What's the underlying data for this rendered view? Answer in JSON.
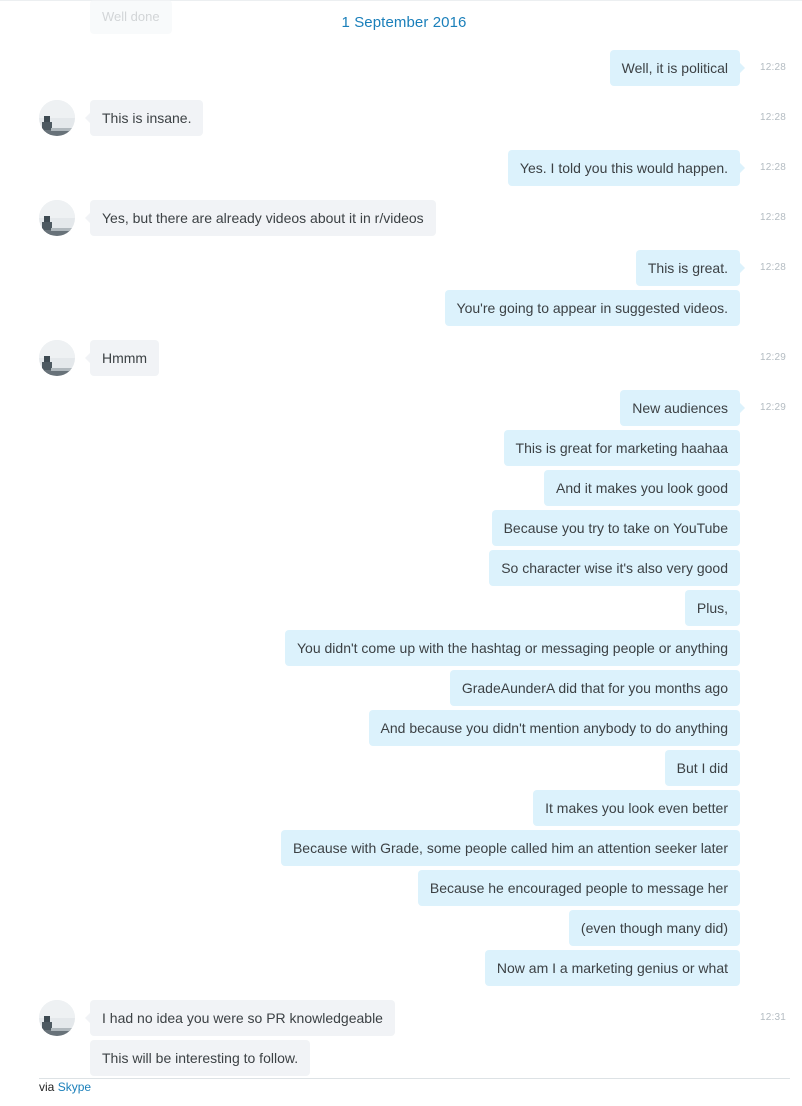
{
  "chat": {
    "partial_previous_message": "Well done",
    "date_header": "1 September 2016",
    "messages": [
      {
        "dir": "out",
        "text": "Well, it is political",
        "time": "12:28"
      },
      {
        "dir": "in",
        "text": "This is insane.",
        "time": "12:28",
        "avatar": true
      },
      {
        "dir": "out",
        "text": "Yes. I told you this would happen.",
        "time": "12:28"
      },
      {
        "dir": "in",
        "text": "Yes, but there are already videos about it in r/videos",
        "time": "12:28",
        "avatar": true
      },
      {
        "dir": "out",
        "text": "This is great.",
        "time": "12:28"
      },
      {
        "dir": "out",
        "text": "You're going to appear in suggested videos.",
        "time": ""
      },
      {
        "dir": "in",
        "text": "Hmmm",
        "time": "12:29",
        "avatar": true
      },
      {
        "dir": "out",
        "text": "New audiences",
        "time": "12:29"
      },
      {
        "dir": "out",
        "text": "This is great for marketing haahaa",
        "time": ""
      },
      {
        "dir": "out",
        "text": "And it makes you look good",
        "time": ""
      },
      {
        "dir": "out",
        "text": "Because you try to take on YouTube",
        "time": ""
      },
      {
        "dir": "out",
        "text": "So character wise it's also very good",
        "time": ""
      },
      {
        "dir": "out",
        "text": "Plus,",
        "time": ""
      },
      {
        "dir": "out",
        "text": "You didn't come up with the hashtag or messaging people or anything",
        "time": ""
      },
      {
        "dir": "out",
        "text": "GradeAunderA did that for you months ago",
        "time": ""
      },
      {
        "dir": "out",
        "text": "And because you didn't mention anybody to do anything",
        "time": ""
      },
      {
        "dir": "out",
        "text": "But I did",
        "time": ""
      },
      {
        "dir": "out",
        "text": "It makes you look even better",
        "time": ""
      },
      {
        "dir": "out",
        "text": "Because with Grade, some people called him an attention seeker later",
        "time": ""
      },
      {
        "dir": "out",
        "text": "Because he encouraged people to message her",
        "time": ""
      },
      {
        "dir": "out",
        "text": "(even though many did)",
        "time": ""
      },
      {
        "dir": "out",
        "text": "Now am I a marketing genius or what",
        "time": ""
      },
      {
        "dir": "in",
        "text": "I had no idea you were so PR knowledgeable",
        "time": "12:31",
        "avatar": true
      },
      {
        "dir": "in",
        "text": "This will be interesting to follow.",
        "time": ""
      }
    ]
  },
  "footer": {
    "prefix": "via",
    "link_label": "Skype"
  },
  "colors": {
    "outgoing_bubble": "#dcf2fc",
    "incoming_bubble": "#f1f3f6",
    "accent": "#1a7fba",
    "timestamp": "#b4bcc2"
  },
  "icons": {
    "avatar": "contact-photo-avatar"
  }
}
